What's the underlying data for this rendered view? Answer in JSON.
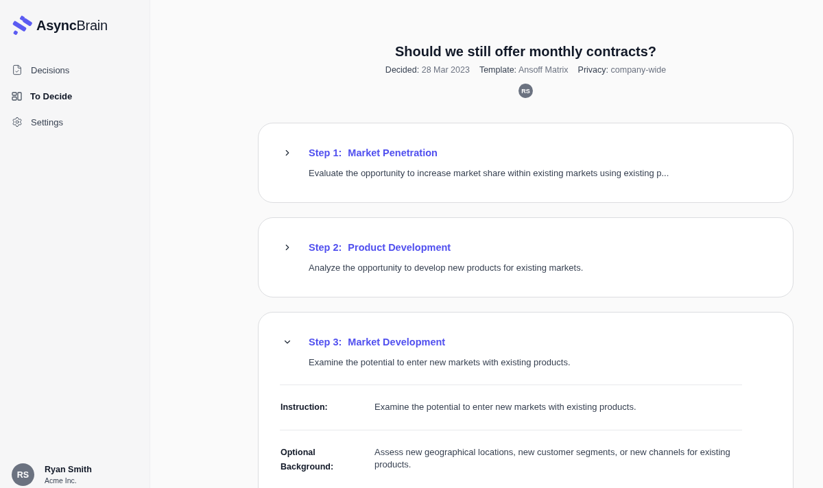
{
  "sidebar": {
    "logo": "**Async**Brain",
    "nav": [
      {
        "kind": "document",
        "label": "Decisions",
        "selected": false
      },
      {
        "kind": "layout",
        "label": "To Decide",
        "selected": true
      },
      {
        "kind": "settings",
        "label": "Settings",
        "selected": false
      }
    ],
    "user": {
      "initials": "RS",
      "name": "Ryan Smith",
      "company": "Acme Inc."
    }
  },
  "decision": {
    "title": "Should we still offer monthly contracts?",
    "meta": [
      {
        "label": "Decided:",
        "value": "28 Mar 2023"
      },
      {
        "label": "Template:",
        "value": "Ansoff Matrix"
      },
      {
        "label": "Privacy:",
        "value": "company-wide"
      }
    ],
    "participants": [
      {
        "initials": "RS"
      }
    ]
  },
  "steps": [
    {
      "number": "Step 1:",
      "title": "Market Penetration",
      "description": "Evaluate the opportunity to increase market share within existing markets using existing p...",
      "expanded": false
    },
    {
      "number": "Step 2:",
      "title": "Product Development",
      "description": "Analyze the opportunity to develop new products for existing markets.",
      "expanded": false
    },
    {
      "number": "Step 3:",
      "title": "Market Development",
      "description": "Examine the potential to enter new markets with existing products.",
      "expanded": true,
      "details": [
        {
          "label": "Instruction:",
          "value": "Examine the potential to enter new markets with existing products."
        },
        {
          "label": "Optional Background:",
          "value": "Assess new geographical locations, new customer segments, or new channels for existing products."
        }
      ]
    }
  ]
}
